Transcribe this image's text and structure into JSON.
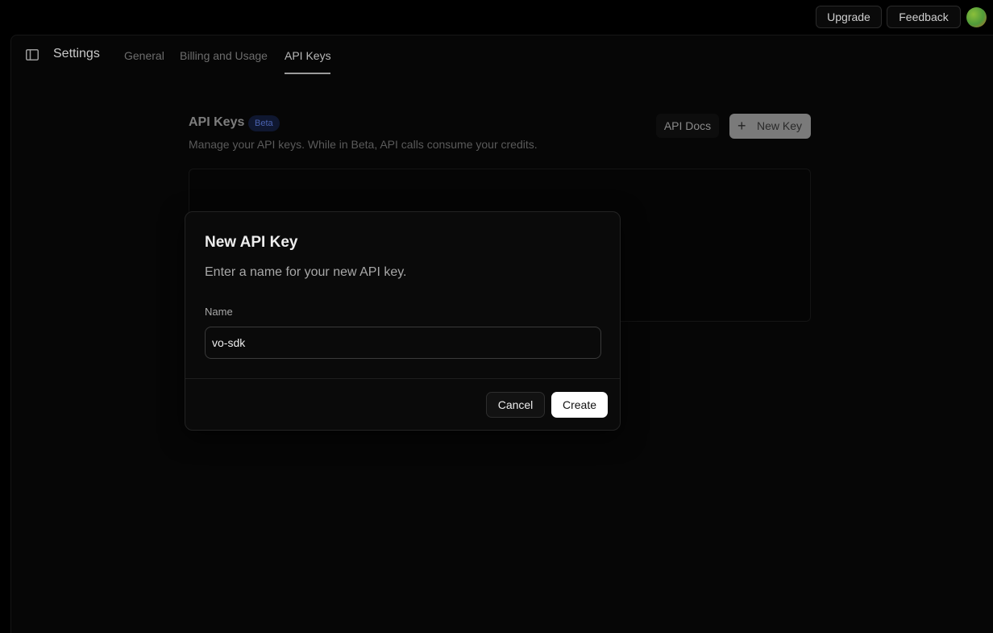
{
  "topbar": {
    "upgrade_label": "Upgrade",
    "feedback_label": "Feedback"
  },
  "header": {
    "title": "Settings",
    "tabs": [
      {
        "label": "General",
        "active": false
      },
      {
        "label": "Billing and Usage",
        "active": false
      },
      {
        "label": "API Keys",
        "active": true
      }
    ]
  },
  "section": {
    "title": "API Keys",
    "badge": "Beta",
    "description": "Manage your API keys. While in Beta, API calls consume your credits.",
    "api_docs_label": "API Docs",
    "new_key_label": "New Key"
  },
  "modal": {
    "title": "New API Key",
    "description": "Enter a name for your new API key.",
    "name_label": "Name",
    "name_value": "vo-sdk",
    "cancel_label": "Cancel",
    "create_label": "Create"
  },
  "colors": {
    "background": "#000000",
    "panel": "#060606",
    "accent_badge": "#4a62b0",
    "primary_button": "#ffffff"
  }
}
